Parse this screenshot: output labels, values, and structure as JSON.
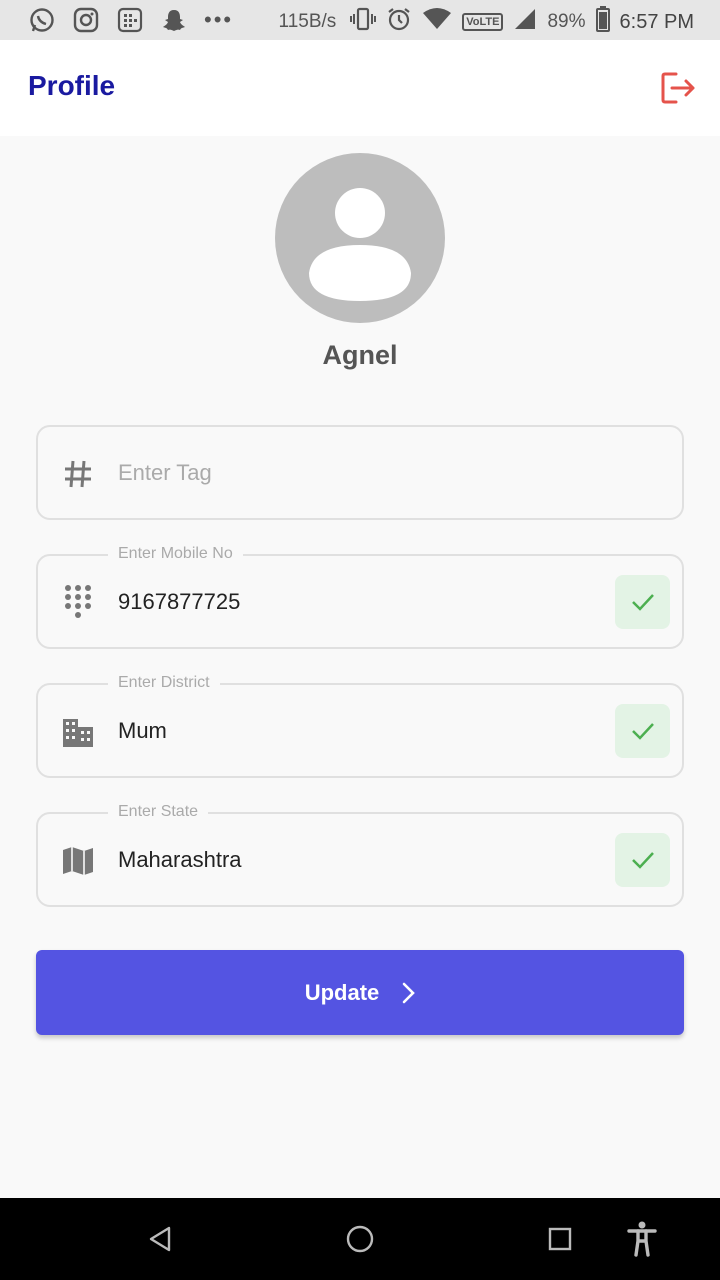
{
  "status_bar": {
    "net_speed": "115B/s",
    "volte": "VoLTE",
    "battery": "89%",
    "time": "6:57 PM",
    "icons": [
      "whatsapp-icon",
      "instagram-icon",
      "app-grid-icon",
      "snapchat-icon",
      "more-dots-icon",
      "vibrate-icon",
      "alarm-icon",
      "wifi-icon",
      "signal-icon",
      "battery-icon"
    ]
  },
  "app_bar": {
    "title": "Profile",
    "logout_icon": "logout-icon"
  },
  "profile": {
    "name": "Agnel",
    "avatar_icon": "person-avatar-icon"
  },
  "form": {
    "tag": {
      "placeholder": "Enter Tag",
      "value": "",
      "icon": "hash-icon"
    },
    "mobile": {
      "label": "Enter Mobile No",
      "value": "9167877725",
      "icon": "dialpad-icon",
      "valid": true
    },
    "district": {
      "label": "Enter District",
      "value": "Mum",
      "icon": "building-icon",
      "valid": true
    },
    "state": {
      "label": "Enter State",
      "value": "Maharashtra",
      "icon": "map-icon",
      "valid": true
    }
  },
  "update_button": {
    "label": "Update",
    "icon": "chevron-right-icon"
  },
  "colors": {
    "primary": "#5454e2",
    "title": "#1a1aa0",
    "logout": "#e5534b",
    "check_bg": "#e3f3e5",
    "check": "#4caf50",
    "avatar": "#bdbdbd"
  }
}
